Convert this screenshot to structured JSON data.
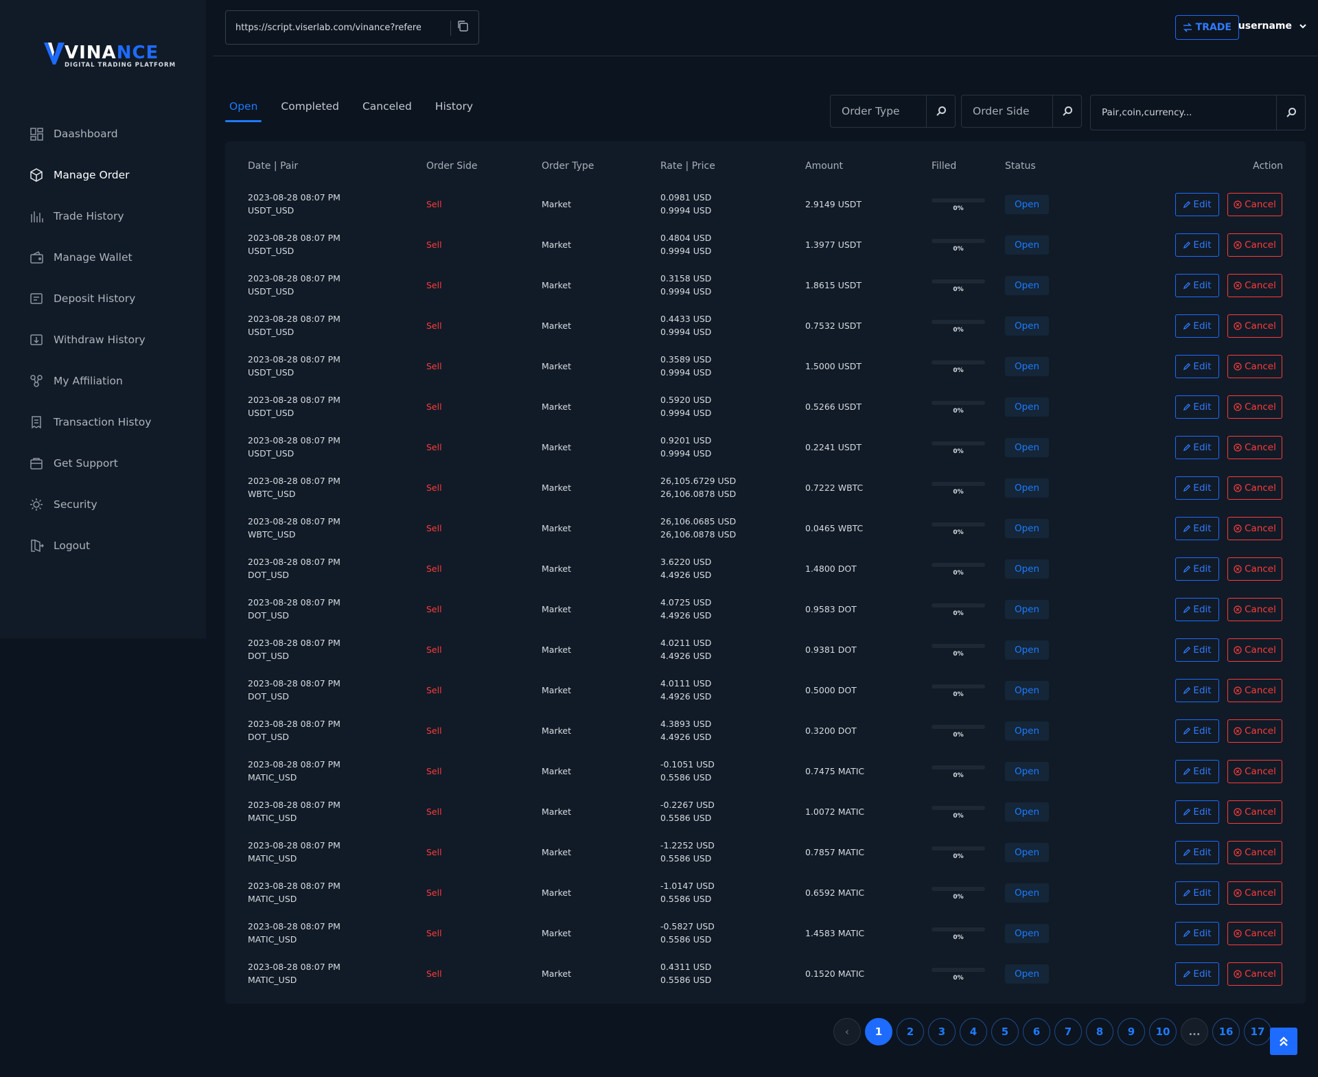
{
  "brand": {
    "name_part1": "VINA",
    "name_part2": "NCE",
    "tagline": "DIGITAL TRADING PLATFORM"
  },
  "sidebar": {
    "items": [
      {
        "label": "Daashboard",
        "icon": "dashboard-icon",
        "active": false
      },
      {
        "label": "Manage Order",
        "icon": "order-icon",
        "active": true
      },
      {
        "label": "Trade History",
        "icon": "trade-history-icon",
        "active": false
      },
      {
        "label": "Manage Wallet",
        "icon": "wallet-icon",
        "active": false
      },
      {
        "label": "Deposit History",
        "icon": "deposit-icon",
        "active": false
      },
      {
        "label": "Withdraw History",
        "icon": "withdraw-icon",
        "active": false
      },
      {
        "label": "My Affiliation",
        "icon": "affiliation-icon",
        "active": false
      },
      {
        "label": "Transaction Histoy",
        "icon": "transaction-icon",
        "active": false
      },
      {
        "label": "Get Support",
        "icon": "support-icon",
        "active": false
      },
      {
        "label": "Security",
        "icon": "security-icon",
        "active": false
      },
      {
        "label": "Logout",
        "icon": "logout-icon",
        "active": false
      }
    ]
  },
  "topbar": {
    "referral_url": "https://script.viserlab.com/vinance?reference=username",
    "trade_label": "TRADE",
    "username": "username"
  },
  "tabs": [
    {
      "label": "Open",
      "active": true
    },
    {
      "label": "Completed",
      "active": false
    },
    {
      "label": "Canceled",
      "active": false
    },
    {
      "label": "History",
      "active": false
    }
  ],
  "filters": {
    "order_type": "Order Type",
    "order_side": "Order Side",
    "search_placeholder": "Pair,coin,currency..."
  },
  "table": {
    "headers": [
      "Date | Pair",
      "Order Side",
      "Order Type",
      "Rate | Price",
      "Amount",
      "Filled",
      "Status",
      "Action"
    ],
    "edit_label": "Edit",
    "cancel_label": "Cancel",
    "rows": [
      {
        "date": "2023-08-28 08:07 PM",
        "pair": "USDT_USD",
        "side": "Sell",
        "type": "Market",
        "rate": "0.0981 USD",
        "price": "0.9994 USD",
        "amount": "2.9149 USDT",
        "filled": "0%",
        "status": "Open"
      },
      {
        "date": "2023-08-28 08:07 PM",
        "pair": "USDT_USD",
        "side": "Sell",
        "type": "Market",
        "rate": "0.4804 USD",
        "price": "0.9994 USD",
        "amount": "1.3977 USDT",
        "filled": "0%",
        "status": "Open"
      },
      {
        "date": "2023-08-28 08:07 PM",
        "pair": "USDT_USD",
        "side": "Sell",
        "type": "Market",
        "rate": "0.3158 USD",
        "price": "0.9994 USD",
        "amount": "1.8615 USDT",
        "filled": "0%",
        "status": "Open"
      },
      {
        "date": "2023-08-28 08:07 PM",
        "pair": "USDT_USD",
        "side": "Sell",
        "type": "Market",
        "rate": "0.4433 USD",
        "price": "0.9994 USD",
        "amount": "0.7532 USDT",
        "filled": "0%",
        "status": "Open"
      },
      {
        "date": "2023-08-28 08:07 PM",
        "pair": "USDT_USD",
        "side": "Sell",
        "type": "Market",
        "rate": "0.3589 USD",
        "price": "0.9994 USD",
        "amount": "1.5000 USDT",
        "filled": "0%",
        "status": "Open"
      },
      {
        "date": "2023-08-28 08:07 PM",
        "pair": "USDT_USD",
        "side": "Sell",
        "type": "Market",
        "rate": "0.5920 USD",
        "price": "0.9994 USD",
        "amount": "0.5266 USDT",
        "filled": "0%",
        "status": "Open"
      },
      {
        "date": "2023-08-28 08:07 PM",
        "pair": "USDT_USD",
        "side": "Sell",
        "type": "Market",
        "rate": "0.9201 USD",
        "price": "0.9994 USD",
        "amount": "0.2241 USDT",
        "filled": "0%",
        "status": "Open"
      },
      {
        "date": "2023-08-28 08:07 PM",
        "pair": "WBTC_USD",
        "side": "Sell",
        "type": "Market",
        "rate": "26,105.6729 USD",
        "price": "26,106.0878 USD",
        "amount": "0.7222 WBTC",
        "filled": "0%",
        "status": "Open"
      },
      {
        "date": "2023-08-28 08:07 PM",
        "pair": "WBTC_USD",
        "side": "Sell",
        "type": "Market",
        "rate": "26,106.0685 USD",
        "price": "26,106.0878 USD",
        "amount": "0.0465 WBTC",
        "filled": "0%",
        "status": "Open"
      },
      {
        "date": "2023-08-28 08:07 PM",
        "pair": "DOT_USD",
        "side": "Sell",
        "type": "Market",
        "rate": "3.6220 USD",
        "price": "4.4926 USD",
        "amount": "1.4800 DOT",
        "filled": "0%",
        "status": "Open"
      },
      {
        "date": "2023-08-28 08:07 PM",
        "pair": "DOT_USD",
        "side": "Sell",
        "type": "Market",
        "rate": "4.0725 USD",
        "price": "4.4926 USD",
        "amount": "0.9583 DOT",
        "filled": "0%",
        "status": "Open"
      },
      {
        "date": "2023-08-28 08:07 PM",
        "pair": "DOT_USD",
        "side": "Sell",
        "type": "Market",
        "rate": "4.0211 USD",
        "price": "4.4926 USD",
        "amount": "0.9381 DOT",
        "filled": "0%",
        "status": "Open"
      },
      {
        "date": "2023-08-28 08:07 PM",
        "pair": "DOT_USD",
        "side": "Sell",
        "type": "Market",
        "rate": "4.0111 USD",
        "price": "4.4926 USD",
        "amount": "0.5000 DOT",
        "filled": "0%",
        "status": "Open"
      },
      {
        "date": "2023-08-28 08:07 PM",
        "pair": "DOT_USD",
        "side": "Sell",
        "type": "Market",
        "rate": "4.3893 USD",
        "price": "4.4926 USD",
        "amount": "0.3200 DOT",
        "filled": "0%",
        "status": "Open"
      },
      {
        "date": "2023-08-28 08:07 PM",
        "pair": "MATIC_USD",
        "side": "Sell",
        "type": "Market",
        "rate": "-0.1051 USD",
        "price": "0.5586 USD",
        "amount": "0.7475 MATIC",
        "filled": "0%",
        "status": "Open"
      },
      {
        "date": "2023-08-28 08:07 PM",
        "pair": "MATIC_USD",
        "side": "Sell",
        "type": "Market",
        "rate": "-0.2267 USD",
        "price": "0.5586 USD",
        "amount": "1.0072 MATIC",
        "filled": "0%",
        "status": "Open"
      },
      {
        "date": "2023-08-28 08:07 PM",
        "pair": "MATIC_USD",
        "side": "Sell",
        "type": "Market",
        "rate": "-1.2252 USD",
        "price": "0.5586 USD",
        "amount": "0.7857 MATIC",
        "filled": "0%",
        "status": "Open"
      },
      {
        "date": "2023-08-28 08:07 PM",
        "pair": "MATIC_USD",
        "side": "Sell",
        "type": "Market",
        "rate": "-1.0147 USD",
        "price": "0.5586 USD",
        "amount": "0.6592 MATIC",
        "filled": "0%",
        "status": "Open"
      },
      {
        "date": "2023-08-28 08:07 PM",
        "pair": "MATIC_USD",
        "side": "Sell",
        "type": "Market",
        "rate": "-0.5827 USD",
        "price": "0.5586 USD",
        "amount": "1.4583 MATIC",
        "filled": "0%",
        "status": "Open"
      },
      {
        "date": "2023-08-28 08:07 PM",
        "pair": "MATIC_USD",
        "side": "Sell",
        "type": "Market",
        "rate": "0.4311 USD",
        "price": "0.5586 USD",
        "amount": "0.1520 MATIC",
        "filled": "0%",
        "status": "Open"
      }
    ]
  },
  "pagination": {
    "prev": "‹",
    "pages": [
      "1",
      "2",
      "3",
      "4",
      "5",
      "6",
      "7",
      "8",
      "9",
      "10",
      "...",
      "16",
      "17"
    ],
    "current": "1"
  },
  "colors": {
    "accent": "#1e6bff",
    "sell": "#ff3b3b",
    "background": "#0c141f",
    "panel": "#111b27"
  }
}
